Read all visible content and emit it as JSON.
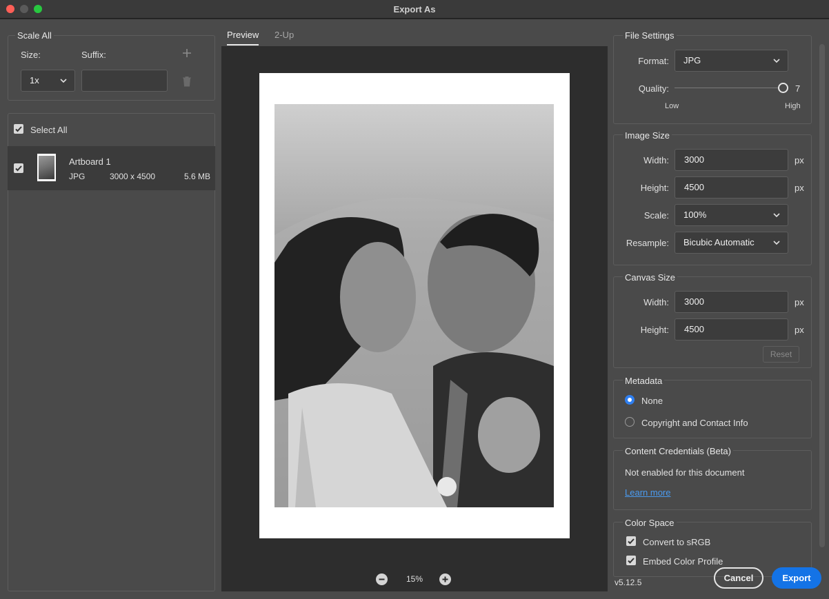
{
  "window": {
    "title": "Export As"
  },
  "scale_all": {
    "title": "Scale All",
    "size_label": "Size:",
    "suffix_label": "Suffix:",
    "size_value": "1x",
    "suffix_value": ""
  },
  "assets": {
    "select_all": "Select All",
    "items": [
      {
        "name": "Artboard 1",
        "format": "JPG",
        "dimensions": "3000 x 4500",
        "filesize": "5.6 MB",
        "checked": true
      }
    ]
  },
  "preview": {
    "tabs": [
      {
        "label": "Preview",
        "active": true
      },
      {
        "label": "2-Up",
        "active": false
      }
    ],
    "zoom": "15%"
  },
  "file_settings": {
    "title": "File Settings",
    "format_label": "Format:",
    "format_value": "JPG",
    "quality_label": "Quality:",
    "quality_value": "7",
    "quality_low": "Low",
    "quality_high": "High"
  },
  "image_size": {
    "title": "Image Size",
    "width_label": "Width:",
    "width_value": "3000",
    "height_label": "Height:",
    "height_value": "4500",
    "unit": "px",
    "scale_label": "Scale:",
    "scale_value": "100%",
    "resample_label": "Resample:",
    "resample_value": "Bicubic Automatic"
  },
  "canvas_size": {
    "title": "Canvas Size",
    "width_label": "Width:",
    "width_value": "3000",
    "height_label": "Height:",
    "height_value": "4500",
    "unit": "px",
    "reset_label": "Reset"
  },
  "metadata": {
    "title": "Metadata",
    "options": [
      {
        "label": "None",
        "selected": true
      },
      {
        "label": "Copyright and Contact Info",
        "selected": false
      }
    ]
  },
  "content_credentials": {
    "title": "Content Credentials (Beta)",
    "status": "Not enabled for this document",
    "learn_more": "Learn more"
  },
  "color_space": {
    "title": "Color Space",
    "convert_srgb": "Convert to sRGB",
    "embed_profile": "Embed Color Profile"
  },
  "footer": {
    "version": "v5.12.5",
    "cancel_label": "Cancel",
    "export_label": "Export"
  },
  "colors": {
    "accent": "#1473e6",
    "radio_selected": "#2f7ff0",
    "link": "#4a9bf0"
  }
}
